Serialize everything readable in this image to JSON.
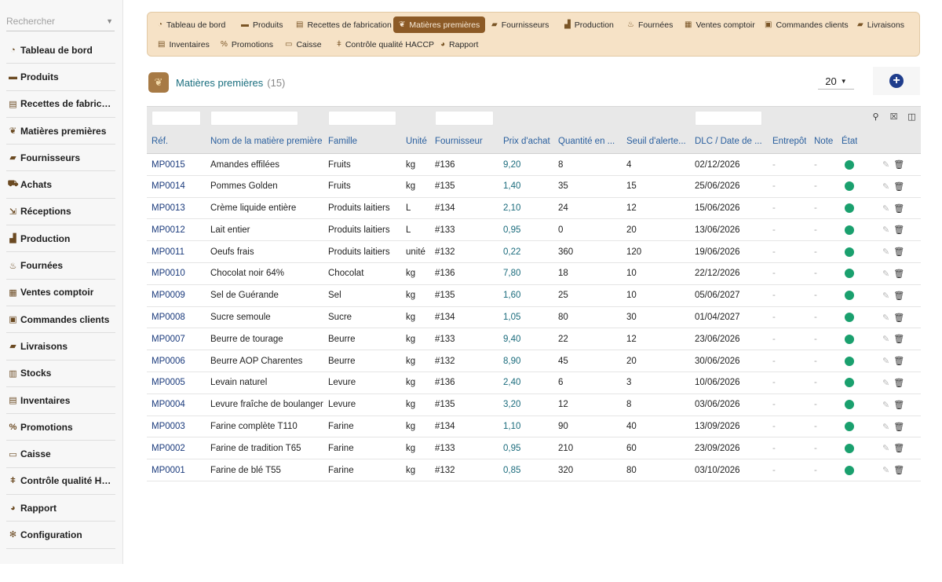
{
  "sidebar": {
    "search_placeholder": "Rechercher",
    "items": [
      {
        "label": "Tableau de bord",
        "icon": "gauge-icon",
        "glyph": "◔"
      },
      {
        "label": "Produits",
        "icon": "bread-icon",
        "glyph": "▬"
      },
      {
        "label": "Recettes de fabrication",
        "icon": "book-icon",
        "glyph": "▤"
      },
      {
        "label": "Matières premières",
        "icon": "seedling-icon",
        "glyph": "❦"
      },
      {
        "label": "Fournisseurs",
        "icon": "truck-icon",
        "glyph": "▰"
      },
      {
        "label": "Achats",
        "icon": "cart-icon",
        "glyph": "⛟"
      },
      {
        "label": "Réceptions",
        "icon": "dolly-icon",
        "glyph": "⇲"
      },
      {
        "label": "Production",
        "icon": "industry-icon",
        "glyph": "▟"
      },
      {
        "label": "Fournées",
        "icon": "fire-icon",
        "glyph": "♨"
      },
      {
        "label": "Ventes comptoir",
        "icon": "cash-register-icon",
        "glyph": "▦"
      },
      {
        "label": "Commandes clients",
        "icon": "clipboard-icon",
        "glyph": "▣"
      },
      {
        "label": "Livraisons",
        "icon": "shipping-icon",
        "glyph": "▰"
      },
      {
        "label": "Stocks",
        "icon": "warehouse-icon",
        "glyph": "▥"
      },
      {
        "label": "Inventaires",
        "icon": "clipboard-list-icon",
        "glyph": "▤"
      },
      {
        "label": "Promotions",
        "icon": "percent-icon",
        "glyph": "%"
      },
      {
        "label": "Caisse",
        "icon": "money-icon",
        "glyph": "▭"
      },
      {
        "label": "Contrôle qualité HACCP",
        "icon": "thermometer-icon",
        "glyph": "ǂ"
      },
      {
        "label": "Rapport",
        "icon": "pie-chart-icon",
        "glyph": "◕"
      },
      {
        "label": "Configuration",
        "icon": "gear-icon",
        "glyph": "✻"
      }
    ]
  },
  "topbar": {
    "tabs": [
      {
        "label": "Tableau de bord",
        "icon": "gauge-icon",
        "glyph": "◔"
      },
      {
        "label": "Produits",
        "icon": "bread-icon",
        "glyph": "▬"
      },
      {
        "label": "Recettes de fabrication",
        "icon": "book-icon",
        "glyph": "▤"
      },
      {
        "label": "Matières premières",
        "icon": "seedling-icon",
        "glyph": "❦",
        "active": true
      },
      {
        "label": "Fournisseurs",
        "icon": "truck-icon",
        "glyph": "▰"
      },
      {
        "label": "Production",
        "icon": "industry-icon",
        "glyph": "▟"
      },
      {
        "label": "Fournées",
        "icon": "fire-icon",
        "glyph": "♨"
      },
      {
        "label": "Ventes comptoir",
        "icon": "cash-register-icon",
        "glyph": "▦"
      },
      {
        "label": "Commandes clients",
        "icon": "clipboard-icon",
        "glyph": "▣"
      },
      {
        "label": "Livraisons",
        "icon": "shipping-icon",
        "glyph": "▰"
      },
      {
        "label": "Inventaires",
        "icon": "clipboard-list-icon",
        "glyph": "▤"
      },
      {
        "label": "Promotions",
        "icon": "percent-icon",
        "glyph": "%"
      },
      {
        "label": "Caisse",
        "icon": "money-icon",
        "glyph": "▭"
      },
      {
        "label": "Contrôle qualité HACCP",
        "icon": "thermometer-icon",
        "glyph": "ǂ"
      },
      {
        "label": "Rapport",
        "icon": "pie-chart-icon",
        "glyph": "◕"
      }
    ]
  },
  "page": {
    "title": "Matières premières",
    "count": "(15)",
    "limit": "20"
  },
  "table": {
    "headers": [
      "Réf.",
      "Nom de la matière première",
      "Famille",
      "Unité",
      "Fournisseur",
      "Prix d'achat",
      "Quantité en ...",
      "Seuil d'alerte...",
      "DLC / Date de ...",
      "Entrepôt",
      "Note",
      "État"
    ],
    "rows": [
      [
        "MP0015",
        "Amandes effilées",
        "Fruits",
        "kg",
        "#136",
        "9,20",
        "8",
        "4",
        "02/12/2026",
        "-",
        "-"
      ],
      [
        "MP0014",
        "Pommes Golden",
        "Fruits",
        "kg",
        "#135",
        "1,40",
        "35",
        "15",
        "25/06/2026",
        "-",
        "-"
      ],
      [
        "MP0013",
        "Crème liquide entière",
        "Produits laitiers",
        "L",
        "#134",
        "2,10",
        "24",
        "12",
        "15/06/2026",
        "-",
        "-"
      ],
      [
        "MP0012",
        "Lait entier",
        "Produits laitiers",
        "L",
        "#133",
        "0,95",
        "0",
        "20",
        "13/06/2026",
        "-",
        "-"
      ],
      [
        "MP0011",
        "Oeufs frais",
        "Produits laitiers",
        "unité",
        "#132",
        "0,22",
        "360",
        "120",
        "19/06/2026",
        "-",
        "-"
      ],
      [
        "MP0010",
        "Chocolat noir 64%",
        "Chocolat",
        "kg",
        "#136",
        "7,80",
        "18",
        "10",
        "22/12/2026",
        "-",
        "-"
      ],
      [
        "MP0009",
        "Sel de Guérande",
        "Sel",
        "kg",
        "#135",
        "1,60",
        "25",
        "10",
        "05/06/2027",
        "-",
        "-"
      ],
      [
        "MP0008",
        "Sucre semoule",
        "Sucre",
        "kg",
        "#134",
        "1,05",
        "80",
        "30",
        "01/04/2027",
        "-",
        "-"
      ],
      [
        "MP0007",
        "Beurre de tourage",
        "Beurre",
        "kg",
        "#133",
        "9,40",
        "22",
        "12",
        "23/06/2026",
        "-",
        "-"
      ],
      [
        "MP0006",
        "Beurre AOP Charentes",
        "Beurre",
        "kg",
        "#132",
        "8,90",
        "45",
        "20",
        "30/06/2026",
        "-",
        "-"
      ],
      [
        "MP0005",
        "Levain naturel",
        "Levure",
        "kg",
        "#136",
        "2,40",
        "6",
        "3",
        "10/06/2026",
        "-",
        "-"
      ],
      [
        "MP0004",
        "Levure fraîche de boulanger",
        "Levure",
        "kg",
        "#135",
        "3,20",
        "12",
        "8",
        "03/06/2026",
        "-",
        "-"
      ],
      [
        "MP0003",
        "Farine complète T110",
        "Farine",
        "kg",
        "#134",
        "1,10",
        "90",
        "40",
        "13/09/2026",
        "-",
        "-"
      ],
      [
        "MP0002",
        "Farine de tradition T65",
        "Farine",
        "kg",
        "#133",
        "0,95",
        "210",
        "60",
        "23/09/2026",
        "-",
        "-"
      ],
      [
        "MP0001",
        "Farine de blé T55",
        "Farine",
        "kg",
        "#132",
        "0,85",
        "320",
        "80",
        "03/10/2026",
        "-",
        "-"
      ]
    ]
  },
  "colors": {
    "accent": "#8c5a26",
    "status_ok": "#1aa06e",
    "link": "#1a3a7c",
    "topbar_bg": "#f6e2c6"
  }
}
